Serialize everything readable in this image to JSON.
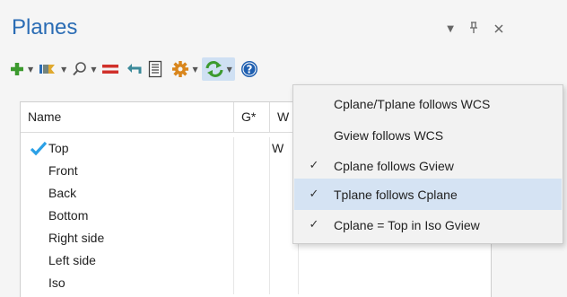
{
  "panel": {
    "title": "Planes"
  },
  "window_controls": {
    "dropdown_glyph": "▼",
    "pin_glyph": "ᴾ",
    "close_glyph": "✕"
  },
  "toolbar": {
    "items": [
      {
        "icon": "plus-icon",
        "has_dropdown": true
      },
      {
        "icon": "select-plane-icon",
        "has_dropdown": true
      },
      {
        "icon": "find-icon",
        "has_dropdown": true
      },
      {
        "icon": "equals-icon",
        "has_dropdown": false
      },
      {
        "icon": "undo-arrow-icon",
        "has_dropdown": false
      },
      {
        "icon": "properties-icon",
        "has_dropdown": false
      },
      {
        "icon": "gear-icon",
        "has_dropdown": true
      },
      {
        "icon": "sync-icon",
        "has_dropdown": true,
        "active": true
      },
      {
        "icon": "help-icon",
        "has_dropdown": false
      }
    ],
    "caret": "▼"
  },
  "table": {
    "columns": [
      "Name",
      "G*",
      "W"
    ],
    "rows": [
      {
        "name": "Top",
        "g": "",
        "w": "W",
        "active": true
      },
      {
        "name": "Front",
        "g": "",
        "w": ""
      },
      {
        "name": "Back",
        "g": "",
        "w": ""
      },
      {
        "name": "Bottom",
        "g": "",
        "w": ""
      },
      {
        "name": "Right side",
        "g": "",
        "w": ""
      },
      {
        "name": "Left side",
        "g": "",
        "w": ""
      },
      {
        "name": "Iso",
        "g": "",
        "w": ""
      }
    ]
  },
  "menu": {
    "items": [
      {
        "label": "Cplane/Tplane follows WCS",
        "checked": false,
        "check_glyph": ""
      },
      {
        "label": "Gview follows WCS",
        "checked": false,
        "check_glyph": ""
      },
      {
        "label": "Cplane follows Gview",
        "checked": true,
        "check_glyph": "✓"
      },
      {
        "label": "Tplane follows Cplane",
        "checked": true,
        "check_glyph": "✓",
        "highlighted": true
      },
      {
        "label": "Cplane = Top in Iso Gview",
        "checked": true,
        "check_glyph": "✓"
      }
    ]
  },
  "colors": {
    "accent": "#2a6cb4",
    "highlight": "#d5e3f3",
    "green": "#3c9a2e",
    "orange": "#d9861c"
  }
}
